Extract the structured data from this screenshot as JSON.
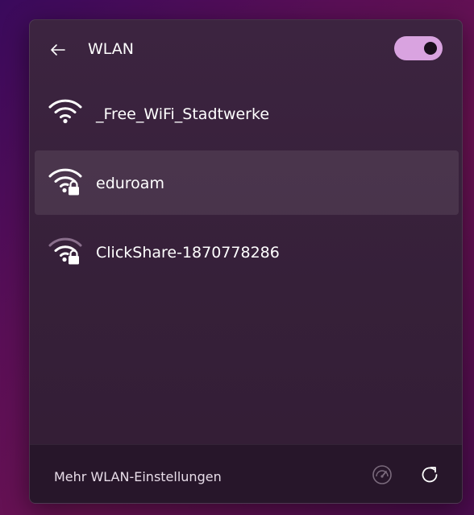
{
  "header": {
    "title": "WLAN",
    "toggle_state": "on"
  },
  "networks": [
    {
      "name": "_Free_WiFi_Stadtwerke",
      "secured": false,
      "signal": "strong",
      "selected": false
    },
    {
      "name": "eduroam",
      "secured": true,
      "signal": "strong",
      "selected": true
    },
    {
      "name": "ClickShare-1870778286",
      "secured": true,
      "signal": "medium",
      "selected": false
    }
  ],
  "footer": {
    "settings_link": "Mehr WLAN-Einstellungen",
    "speed_icon": "speedometer-icon",
    "refresh_icon": "refresh-icon"
  },
  "colors": {
    "accent": "#d9a3e0",
    "panel": "#3a2240",
    "text": "#ffffff"
  }
}
